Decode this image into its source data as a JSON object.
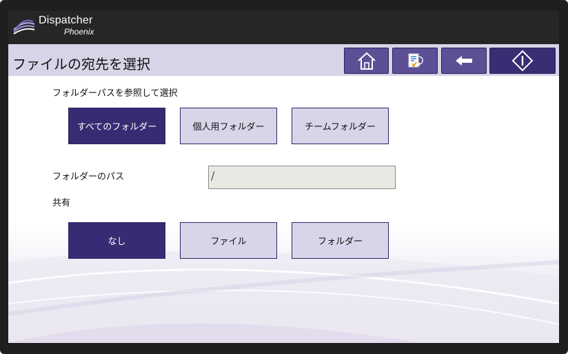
{
  "brand": {
    "name": "Dispatcher",
    "sub": "Phoenix",
    "logo_icon": "dispatcher-phoenix-logo-icon"
  },
  "header": {
    "title": "ファイルの宛先を選択",
    "buttons": [
      {
        "icon": "home-icon"
      },
      {
        "icon": "scan-return-icon"
      },
      {
        "icon": "back-arrow-icon"
      },
      {
        "icon": "start-diamond-icon"
      }
    ]
  },
  "folder_browse": {
    "label": "フォルダーパスを参照して選択",
    "options": [
      {
        "label": "すべてのフォルダー",
        "selected": true
      },
      {
        "label": "個人用フォルダー",
        "selected": false
      },
      {
        "label": "チームフォルダー",
        "selected": false
      }
    ]
  },
  "folder_path": {
    "label": "フォルダーのパス",
    "value": "/"
  },
  "share": {
    "label": "共有",
    "options": [
      {
        "label": "なし",
        "selected": true
      },
      {
        "label": "ファイル",
        "selected": false
      },
      {
        "label": "フォルダー",
        "selected": false
      }
    ]
  },
  "colors": {
    "accent": "#382b73",
    "header_bg": "#d8d3e6",
    "topbar_bg": "#262626",
    "unselected_bg": "#d9d4e8"
  }
}
